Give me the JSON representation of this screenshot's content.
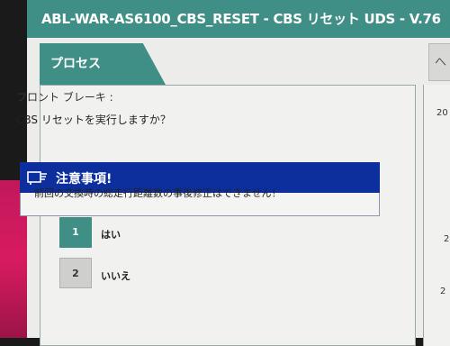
{
  "window": {
    "title": "ABL-WAR-AS6100_CBS_RESET - CBS リセット UDS - V.76"
  },
  "tabs": [
    {
      "label": "プロセス"
    },
    {
      "label": "へ"
    }
  ],
  "content": {
    "section_label": "フロント ブレーキ :",
    "question": "CBS リセットを実行しますか？"
  },
  "notice": {
    "title": "注意事項!",
    "icon": "notice-hand-icon",
    "message": "前回の交換時の総走行距離数の事後修正はできません！"
  },
  "options": [
    {
      "number": "1",
      "label": "はい"
    },
    {
      "number": "2",
      "label": "いいえ"
    }
  ],
  "side_values": [
    "20",
    "2",
    "2"
  ],
  "colors": {
    "teal": "#3f8f86",
    "notice_blue": "#0d2f9e",
    "panel_bg": "#f1f1ef"
  }
}
